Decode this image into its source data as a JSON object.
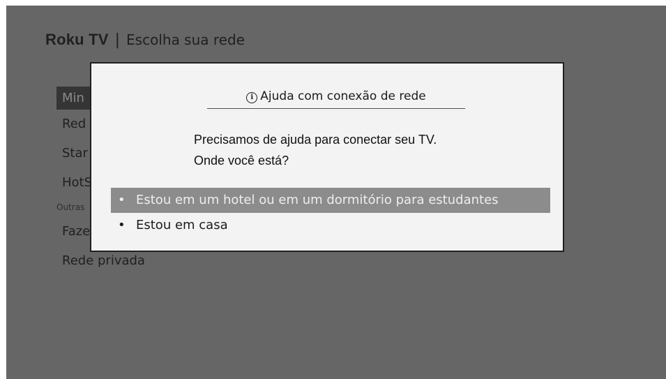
{
  "header": {
    "brand": "Roku TV",
    "separator": "|",
    "title": "Escolha sua rede"
  },
  "menu": {
    "items": [
      {
        "label": "Min",
        "selected": true
      },
      {
        "label": "Red"
      },
      {
        "label": "Star"
      },
      {
        "label": "HotS"
      }
    ],
    "section_label": "Outras",
    "other_items": [
      {
        "label": "Faze"
      },
      {
        "label": "Rede privada"
      }
    ]
  },
  "dialog": {
    "icon": "info-icon",
    "icon_glyph": "i",
    "title": "Ajuda com conexão de rede",
    "message_line1": "Precisamos de ajuda para conectar seu TV.",
    "message_line2": "Onde você está?",
    "bullet": "•",
    "options": [
      {
        "label": "Estou em um hotel ou em um dormitório para estudantes",
        "highlighted": true
      },
      {
        "label": "Estou em casa",
        "highlighted": false
      }
    ]
  },
  "colors": {
    "screen_bg": "#666666",
    "dialog_bg": "#f3f3f3",
    "highlight": "#8c8c8c",
    "selected_menu": "#353535"
  }
}
